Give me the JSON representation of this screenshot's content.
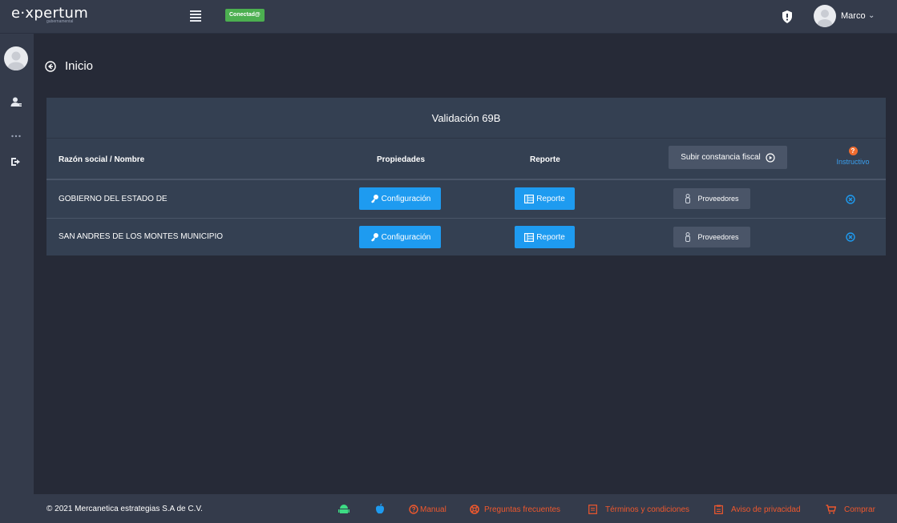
{
  "app": {
    "logo_text": "e·xpertum",
    "logo_sub": "gubernamental",
    "status_badge": "Conectad@",
    "user_name": "Marco",
    "user_chevron": "⌄"
  },
  "page": {
    "title": "Inicio"
  },
  "card": {
    "title": "Validación 69B",
    "headers": {
      "name": "Razón social / Nombre",
      "properties": "Propiedades",
      "report": "Reporte",
      "upload_button": "Subir constancia fiscal",
      "instructions": "Instructivo",
      "instructions_icon": "?"
    },
    "rows": [
      {
        "name": "GOBIERNO DEL ESTADO DE",
        "config_label": "Configuración",
        "report_label": "Reporte",
        "providers_label": "Proveedores"
      },
      {
        "name": "SAN ANDRES DE LOS MONTES MUNICIPIO",
        "config_label": "Configuración",
        "report_label": "Reporte",
        "providers_label": "Proveedores"
      }
    ]
  },
  "footer": {
    "copyright": "© 2021 Mercanetica estrategias S.A de C.V.",
    "links": {
      "manual": "Manual",
      "faq": "Preguntas frecuentes",
      "terms": "Términos y condiciones",
      "privacy": "Aviso de privacidad",
      "buy": "Comprar"
    }
  },
  "colors": {
    "accent_blue": "#1e9bf0",
    "status_green": "#4caf50",
    "footer_link": "#f0582d",
    "card_bg": "#344052",
    "page_bg": "#262a37"
  }
}
